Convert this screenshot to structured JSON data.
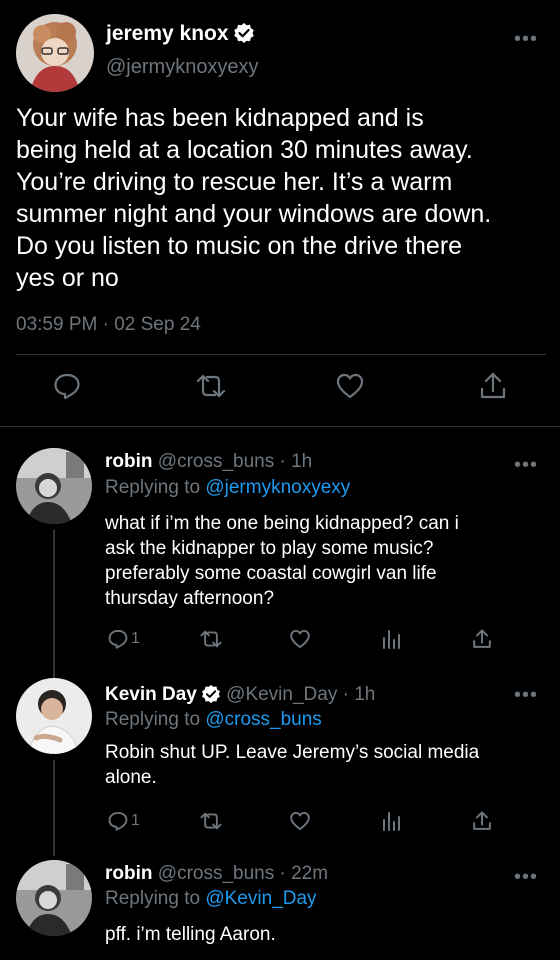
{
  "main_tweet": {
    "author_name": "jeremy knox",
    "author_handle": "@jermyknoxyexy",
    "body": "Your wife has been kidnapped and is\nbeing held at a location 30 minutes away.\nYou’re driving to rescue her. It’s a warm\nsummer night and your windows are down.\nDo you listen to music on the drive there\nyes or no",
    "timestamp": "03:59 PM · 02 Sep 24",
    "more_icon": "more-horizontal-icon",
    "actions": [
      "reply-icon",
      "retweet-icon",
      "like-icon",
      "share-icon"
    ]
  },
  "replies": [
    {
      "author_name": "robin",
      "meta": "@cross_buns · 1h",
      "replying_label": "Replying to",
      "replying_to": "@jermyknoxyexy",
      "body": "what if i’m the one being kidnapped? can i\nask the kidnapper to play some music?\npreferably some coastal cowgirl van life\nthursday afternoon?",
      "reply_count": "1",
      "verified": false
    },
    {
      "author_name": "Kevin Day",
      "meta": "@Kevin_Day · 1h",
      "replying_label": "Replying to",
      "replying_to": "@cross_buns",
      "body": "Robin shut UP. Leave Jeremy’s social media\nalone.",
      "reply_count": "1",
      "verified": true
    },
    {
      "author_name": "robin",
      "meta": "@cross_buns · 22m",
      "replying_label": "Replying to",
      "replying_to": "@Kevin_Day",
      "body": "pff. i’m telling Aaron.",
      "verified": false
    }
  ],
  "colors": {
    "background": "#000000",
    "text": "#e7e9ea",
    "muted": "#6e767d",
    "link": "#1d9bf0",
    "verified_badge": "#ffffff"
  }
}
